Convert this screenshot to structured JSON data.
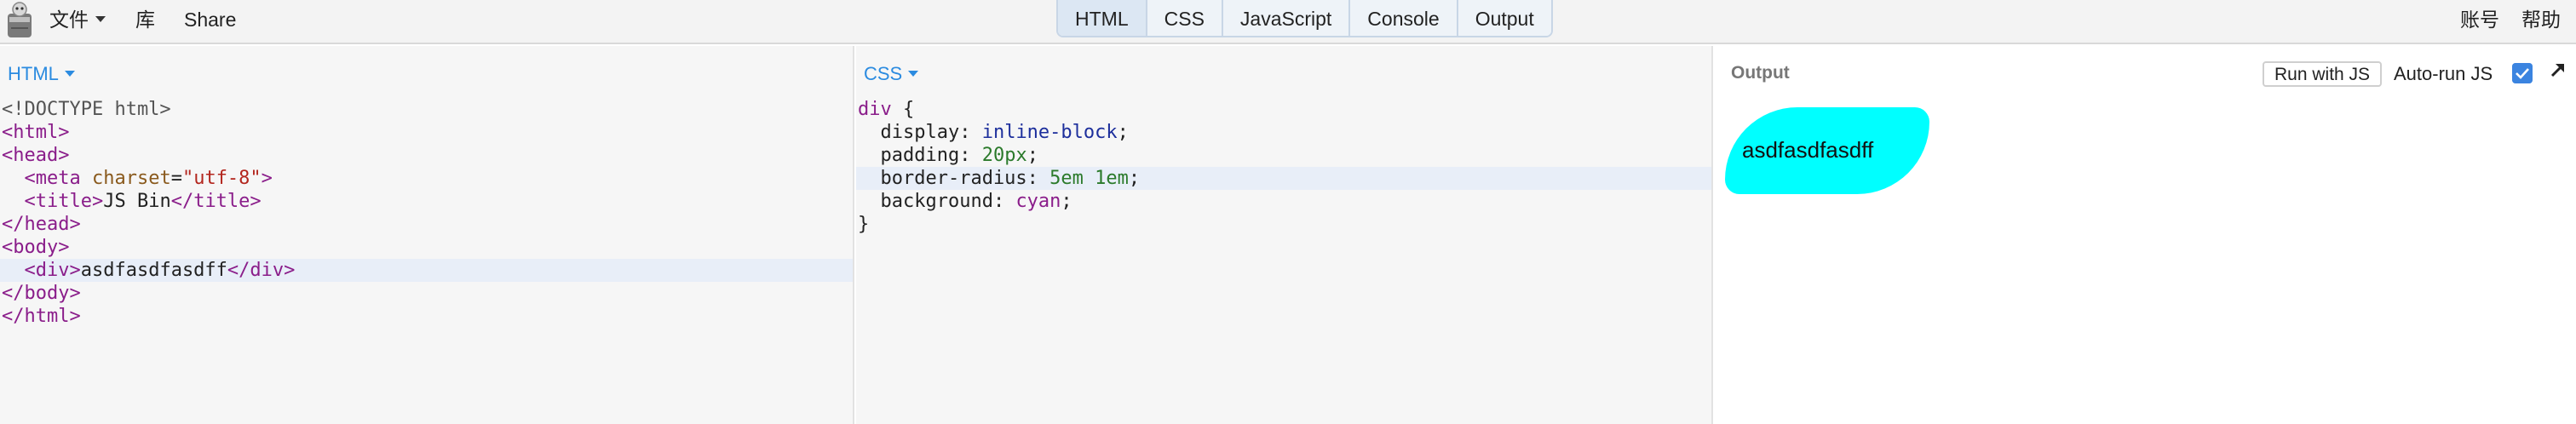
{
  "menu": {
    "file": "文件",
    "library": "库",
    "share": "Share",
    "account": "账号",
    "help": "帮助"
  },
  "tabs": [
    {
      "label": "HTML",
      "active": true
    },
    {
      "label": "CSS",
      "active": false
    },
    {
      "label": "JavaScript",
      "active": false
    },
    {
      "label": "Console",
      "active": false
    },
    {
      "label": "Output",
      "active": false
    }
  ],
  "html_panel": {
    "label": "HTML",
    "lines": [
      {
        "t": [
          [
            "doc",
            "<!DOCTYPE html>"
          ]
        ]
      },
      {
        "t": [
          [
            "tag",
            "<html>"
          ]
        ]
      },
      {
        "t": [
          [
            "tag",
            "<head>"
          ]
        ]
      },
      {
        "t": [
          [
            "plain",
            "  "
          ],
          [
            "tag",
            "<meta "
          ],
          [
            "attr",
            "charset"
          ],
          [
            "plain",
            "="
          ],
          [
            "str",
            "\"utf-8\""
          ],
          [
            "tag",
            ">"
          ]
        ]
      },
      {
        "t": [
          [
            "plain",
            "  "
          ],
          [
            "tag",
            "<title>"
          ],
          [
            "plain",
            "JS Bin"
          ],
          [
            "tag",
            "</title>"
          ]
        ]
      },
      {
        "t": [
          [
            "tag",
            "</head>"
          ]
        ]
      },
      {
        "t": [
          [
            "tag",
            "<body>"
          ]
        ]
      },
      {
        "t": [
          [
            "plain",
            "  "
          ],
          [
            "tag",
            "<div>"
          ],
          [
            "plain",
            "asdfasdfasdff"
          ],
          [
            "tag",
            "</div>"
          ]
        ],
        "highlight": true
      },
      {
        "t": [
          [
            "tag",
            "</body>"
          ]
        ]
      },
      {
        "t": [
          [
            "tag",
            "</html>"
          ]
        ]
      }
    ]
  },
  "css_panel": {
    "label": "CSS",
    "lines": [
      {
        "t": [
          [
            "sel",
            "div"
          ],
          [
            "plain",
            " {"
          ]
        ]
      },
      {
        "t": [
          [
            "plain",
            "  display: "
          ],
          [
            "kw",
            "inline-block"
          ],
          [
            "plain",
            ";"
          ]
        ]
      },
      {
        "t": [
          [
            "plain",
            "  padding: "
          ],
          [
            "num",
            "20px"
          ],
          [
            "plain",
            ";"
          ]
        ]
      },
      {
        "t": [
          [
            "plain",
            "  border-radius: "
          ],
          [
            "num",
            "5em 1em"
          ],
          [
            "plain",
            ";"
          ]
        ],
        "highlight": true
      },
      {
        "t": [
          [
            "plain",
            "  background: "
          ],
          [
            "sel",
            "cyan"
          ],
          [
            "plain",
            ";"
          ]
        ]
      },
      {
        "t": [
          [
            "plain",
            "}"
          ]
        ]
      }
    ]
  },
  "output_panel": {
    "label": "Output",
    "run_button": "Run with JS",
    "autorun_label": "Auto-run JS",
    "autorun_checked": true,
    "rendered_text": "asdfasdfasdff"
  },
  "colors": {
    "accent": "#2b8be0",
    "checkbox": "#3b84e0",
    "demo_background": "cyan"
  }
}
